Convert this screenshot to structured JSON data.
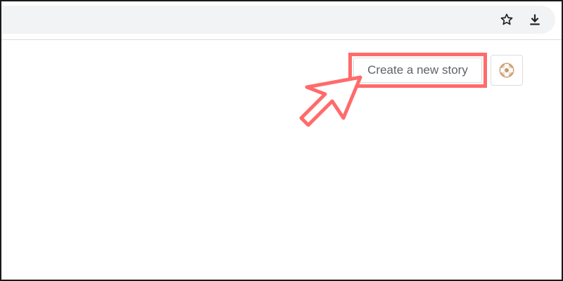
{
  "browser": {
    "toolbar_icons": [
      "star-icon",
      "download-icon"
    ]
  },
  "page": {
    "create_story_label": "Create a new story",
    "avatar_icon": "avatar-icon"
  },
  "annotation": {
    "highlight_color": "#ff6b6b"
  }
}
